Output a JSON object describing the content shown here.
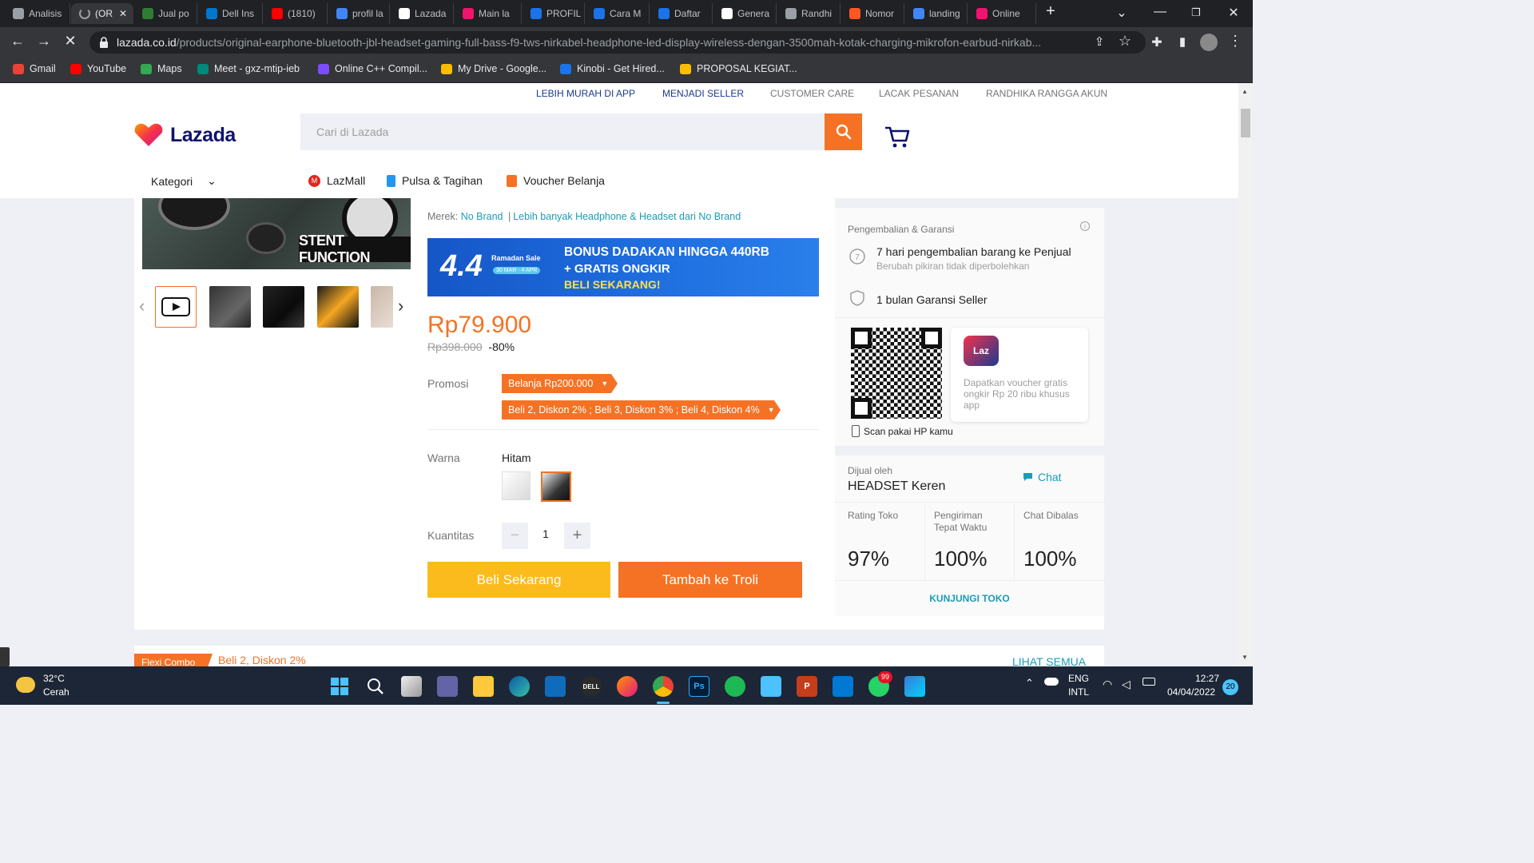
{
  "browser": {
    "tabs": [
      {
        "label": "Analisis",
        "color": "#9aa0a6"
      },
      {
        "label": "(OR",
        "color": "#9aa0a6"
      },
      {
        "label": "Jual po",
        "color": "#2e7d32"
      },
      {
        "label": "Dell Ins",
        "color": "#0076ce"
      },
      {
        "label": "(1810)",
        "color": "#ff0000"
      },
      {
        "label": "profil la",
        "color": "#4285f4"
      },
      {
        "label": "Lazada",
        "color": "#ffffff"
      },
      {
        "label": "Main la",
        "color": "#f0146e"
      },
      {
        "label": "PROFIL",
        "color": "#1a73e8"
      },
      {
        "label": "Cara M",
        "color": "#1a73e8"
      },
      {
        "label": "Daftar",
        "color": "#1a73e8"
      },
      {
        "label": "Genera",
        "color": "#ffffff"
      },
      {
        "label": "Randhi",
        "color": "#9aa0a6"
      },
      {
        "label": "Nomor",
        "color": "#ff5722"
      },
      {
        "label": "landing",
        "color": "#4285f4"
      },
      {
        "label": "Online",
        "color": "#f0146e"
      }
    ],
    "url_host": "lazada.co.id",
    "url_path": "/products/original-earphone-bluetooth-jbl-headset-gaming-full-bass-f9-tws-nirkabel-headphone-led-display-wireless-dengan-3500mah-kotak-charging-mikrofon-earbud-nirkab...",
    "bookmarks": [
      {
        "label": "Gmail",
        "color": "#ea4335"
      },
      {
        "label": "YouTube",
        "color": "#ff0000"
      },
      {
        "label": "Maps",
        "color": "#34a853"
      },
      {
        "label": "Meet - gxz-mtip-ieb",
        "color": "#00897b"
      },
      {
        "label": "Online C++ Compil...",
        "color": "#7c4dff"
      },
      {
        "label": "My Drive - Google...",
        "color": "#fbbc04"
      },
      {
        "label": "Kinobi - Get Hired...",
        "color": "#1a73e8"
      },
      {
        "label": "PROPOSAL KEGIAT...",
        "color": "#fbbc04"
      }
    ]
  },
  "site": {
    "topnav": [
      "LEBIH MURAH DI APP",
      "MENJADI SELLER",
      "CUSTOMER CARE",
      "LACAK PESANAN",
      "RANDHIKA RANGGA AKUN"
    ],
    "logo_text": "Lazada",
    "search_placeholder": "Cari di Lazada",
    "category_label": "Kategori",
    "cat_links": [
      "LazMall",
      "Pulsa & Tagihan",
      "Voucher Belanja"
    ]
  },
  "product": {
    "gallery_caption": "STENT FUNCTION",
    "brand_label": "Merek:",
    "brand": "No Brand",
    "brand_more": "Lebih banyak Headphone & Headset dari No Brand",
    "banner": {
      "event": "4.4",
      "event_sub": "Ramadan Sale",
      "event_dates": "30 MAR - 4 APR",
      "line1": "BONUS DADAKAN HINGGA 440RB",
      "line2": "+ GRATIS ONGKIR",
      "line3": "BELI SEKARANG!"
    },
    "price": "Rp79.900",
    "original_price": "Rp398.000",
    "discount": "-80%",
    "promo_label": "Promosi",
    "promos": [
      "Belanja Rp200.000",
      "Beli 2, Diskon 2% ; Beli 3, Diskon 3% ; Beli 4, Diskon 4%"
    ],
    "color_label": "Warna",
    "color_value": "Hitam",
    "qty_label": "Kuantitas",
    "qty_value": "1",
    "buy_now": "Beli Sekarang",
    "add_to_cart": "Tambah ke Troli"
  },
  "side": {
    "warranty_title": "Pengembalian & Garansi",
    "return_title": "7 hari pengembalian barang ke Penjual",
    "return_sub": "Berubah pikiran tidak diperbolehkan",
    "warranty": "1 bulan Garansi Seller",
    "laz_badge": "Laz",
    "app_promo": "Dapatkan voucher gratis ongkir Rp 20 ribu khusus app",
    "scan_label": "Scan pakai HP kamu",
    "sold_by_label": "Dijual oleh",
    "seller": "HEADSET Keren",
    "chat": "Chat",
    "stats": [
      {
        "label": "Rating Toko",
        "value": "97%"
      },
      {
        "label": "Pengiriman Tepat Waktu",
        "value": "100%"
      },
      {
        "label": "Chat Dibalas",
        "value": "100%"
      }
    ],
    "visit_store": "KUNJUNGI TOKO"
  },
  "flexi": {
    "tag": "Flexi Combo",
    "text": "Beli 2, Diskon 2%",
    "see_all": "LIHAT SEMUA"
  },
  "taskbar": {
    "weather_temp": "32°C",
    "weather_desc": "Cerah",
    "lang1": "ENG",
    "lang2": "INTL",
    "time": "12:27",
    "date": "04/04/2022",
    "notif_count": "20",
    "whatsapp_badge": "99"
  }
}
